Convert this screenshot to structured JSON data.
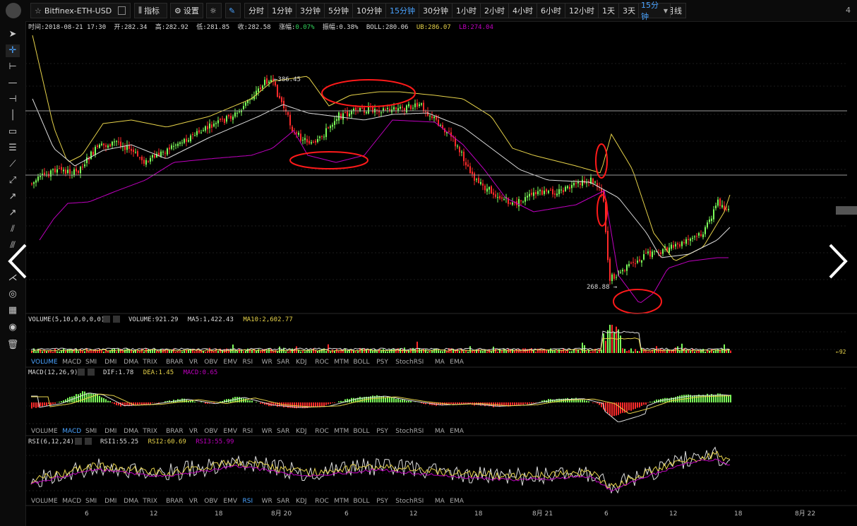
{
  "toolbar_top": {
    "symbol": "Bitfinex-ETH-USD",
    "indicator_label": "指标",
    "settings_label": "设置",
    "timeframes": [
      "分时",
      "1分钟",
      "3分钟",
      "5分钟",
      "10分钟",
      "15分钟",
      "30分钟",
      "1小时",
      "2小时",
      "4小时",
      "6小时",
      "12小时",
      "1天",
      "3天",
      "周线",
      "月线"
    ],
    "active_timeframe": "15分钟",
    "dropdown_value": "15分钟",
    "corner_number": "4"
  },
  "info_bar": {
    "time": "时间:2018-08-21 17:30",
    "open": "开:282.34",
    "high": "高:282.92",
    "low": "低:281.85",
    "close": "收:282.58",
    "change_label": "涨幅:",
    "change_value": "0.07%",
    "amp_label": "振幅:",
    "amp_value": "0.38%",
    "boll": "BOLL:280.06",
    "ub": "UB:286.07",
    "lb": "LB:274.04"
  },
  "price_labels": {
    "high": "386.45",
    "low": "268.88"
  },
  "volume_panel": {
    "header": "VOLUME(5,10,0,0,0,0)",
    "volume": "VOLUME:921.29",
    "ma5": "MA5:1,422.43",
    "ma10": "MA10:2,602.77",
    "right_label": "←92"
  },
  "macd_panel": {
    "header": "MACD(12,26,9)",
    "dif": "DIF:1.78",
    "dea": "DEA:1.45",
    "macd": "MACD:0.65"
  },
  "rsi_panel": {
    "header": "RSI(6,12,24)",
    "rsi1": "RSI1:55.25",
    "rsi2": "RSI2:60.69",
    "rsi3": "RSI3:55.99"
  },
  "indicator_tabs": [
    "VOLUME",
    "MACD",
    "SMI",
    "DMI",
    "DMA",
    "TRIX",
    "BRAR",
    "VR",
    "OBV",
    "EMV",
    "RSI",
    "WR",
    "SAR",
    "KDJ",
    "ROC",
    "MTM",
    "BOLL",
    "PSY",
    "StochRSI",
    "MA",
    "EMA"
  ],
  "tabs_active": [
    "VOLUME",
    "MACD",
    "RSI"
  ],
  "x_axis": [
    "6",
    "12",
    "18",
    "8月 20",
    "6",
    "12",
    "18",
    "8月 21",
    "6",
    "12",
    "18",
    "8月 22"
  ],
  "colors": {
    "up": "#7cfc5a",
    "down": "#ff2a2a",
    "ub": "#e6d24a",
    "boll": "#dddddd",
    "lb": "#c000c0",
    "annot": "#ff1a1a",
    "active": "#4aa3ff"
  },
  "chart_data": {
    "type": "candlestick",
    "series": [
      {
        "name": "BOLL"
      },
      {
        "name": "UB"
      },
      {
        "name": "LB"
      }
    ],
    "markers": {
      "high": 386.45,
      "low": 268.88
    }
  }
}
